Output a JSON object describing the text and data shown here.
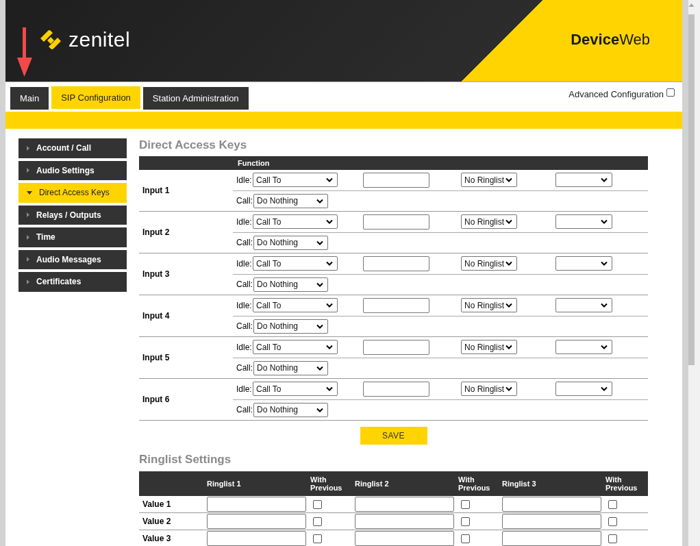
{
  "header": {
    "brand": "zenitel",
    "product": "**Device**Web"
  },
  "tabs": [
    {
      "label": "Main",
      "selected": false
    },
    {
      "label": "SIP Configuration",
      "selected": true
    },
    {
      "label": "Station Administration",
      "selected": false
    }
  ],
  "advanced_configuration": {
    "label": "Advanced Configuration",
    "checked": false
  },
  "sidebar": {
    "items": [
      {
        "label": "Account / Call",
        "selected": false,
        "expanded": false
      },
      {
        "label": "Audio Settings",
        "selected": false,
        "expanded": false
      },
      {
        "label": "Direct Access Keys",
        "selected": true,
        "expanded": true
      },
      {
        "label": "Relays / Outputs",
        "selected": false,
        "expanded": false
      },
      {
        "label": "Time",
        "selected": false,
        "expanded": false
      },
      {
        "label": "Audio Messages",
        "selected": false,
        "expanded": false
      },
      {
        "label": "Certificates",
        "selected": false,
        "expanded": false
      }
    ]
  },
  "direct_access_keys": {
    "title": "Direct Access Keys",
    "function_header": "Function",
    "rows": [
      {
        "label": "Input 1",
        "idle_label": "Idle:",
        "idle_action": "Call To",
        "ringlist": "No Ringlist",
        "call_label": "Call:",
        "call_action": "Do Nothing"
      },
      {
        "label": "Input 2",
        "idle_label": "Idle:",
        "idle_action": "Call To",
        "ringlist": "No Ringlist",
        "call_label": "Call:",
        "call_action": "Do Nothing"
      },
      {
        "label": "Input 3",
        "idle_label": "Idle:",
        "idle_action": "Call To",
        "ringlist": "No Ringlist",
        "call_label": "Call:",
        "call_action": "Do Nothing"
      },
      {
        "label": "Input 4",
        "idle_label": "Idle:",
        "idle_action": "Call To",
        "ringlist": "No Ringlist",
        "call_label": "Call:",
        "call_action": "Do Nothing"
      },
      {
        "label": "Input 5",
        "idle_label": "Idle:",
        "idle_action": "Call To",
        "ringlist": "No Ringlist",
        "call_label": "Call:",
        "call_action": "Do Nothing"
      },
      {
        "label": "Input 6",
        "idle_label": "Idle:",
        "idle_action": "Call To",
        "ringlist": "No Ringlist",
        "call_label": "Call:",
        "call_action": "Do Nothing"
      }
    ],
    "save_button": "SAVE"
  },
  "ringlist_settings": {
    "title": "Ringlist Settings",
    "columns": [
      "Ringlist 1",
      "With Previous",
      "Ringlist 2",
      "With Previous",
      "Ringlist 3",
      "With Previous"
    ],
    "rows": [
      {
        "label": "Value 1",
        "with_previous": [
          false,
          false,
          false
        ]
      },
      {
        "label": "Value 2",
        "with_previous": [
          false,
          false,
          false
        ]
      },
      {
        "label": "Value 3",
        "with_previous": [
          false,
          false,
          false
        ]
      }
    ]
  }
}
